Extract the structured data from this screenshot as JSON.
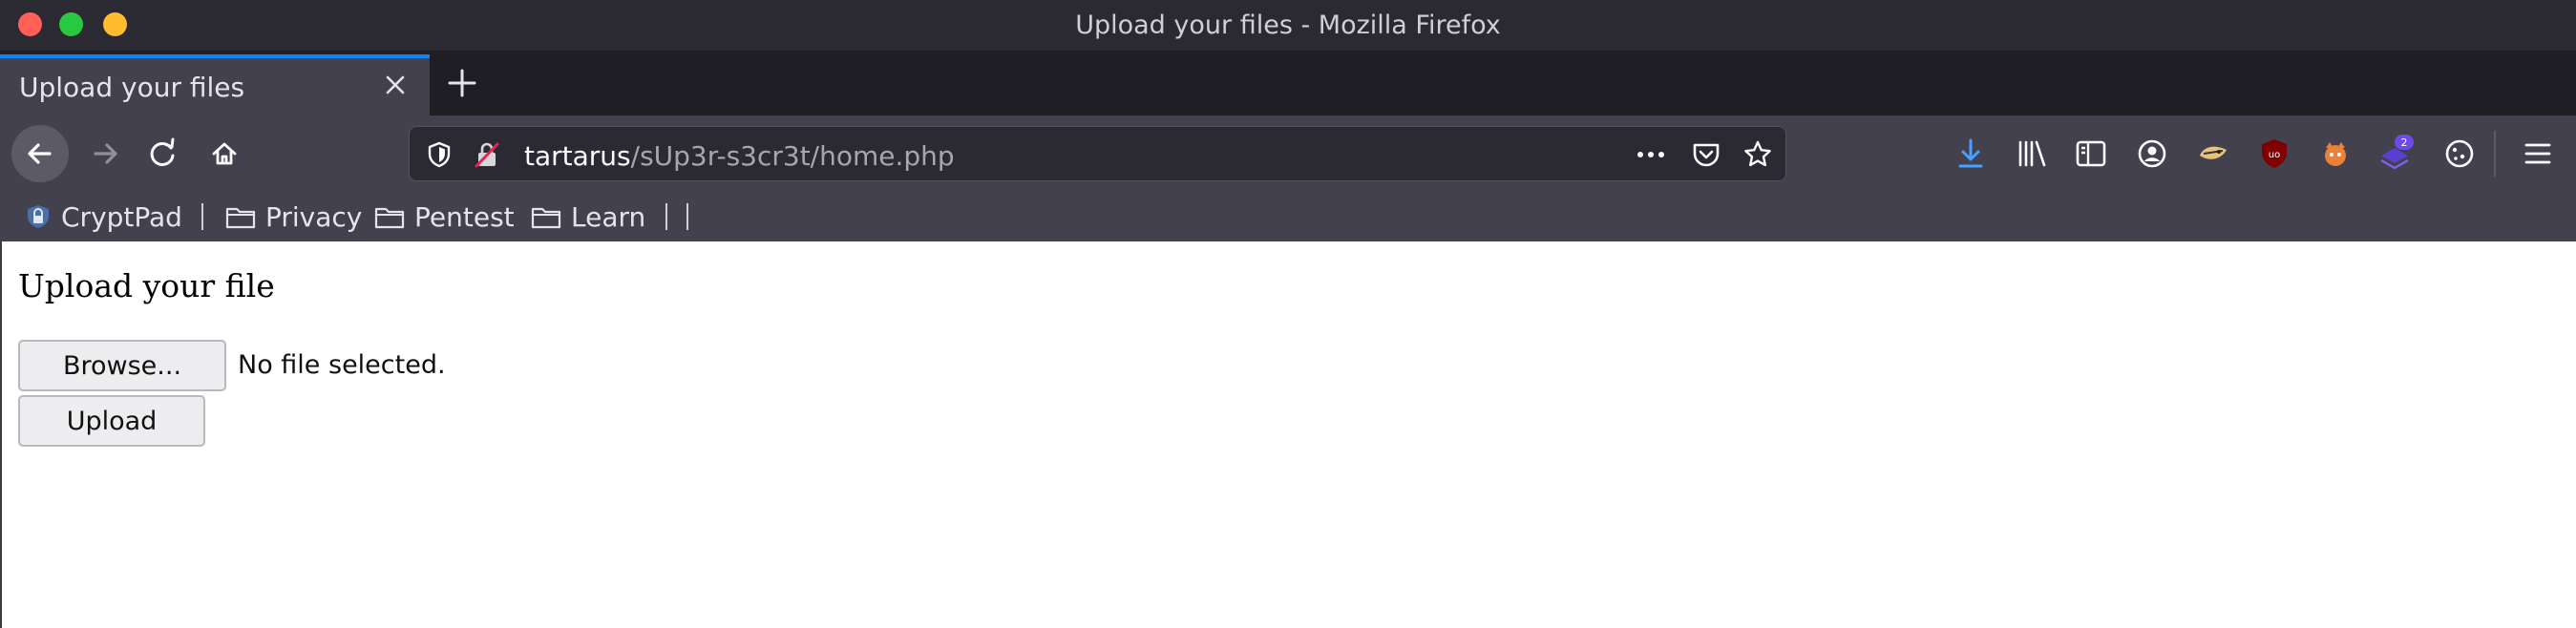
{
  "window": {
    "title": "Upload your files - Mozilla Firefox"
  },
  "tab": {
    "title": "Upload your files"
  },
  "url": {
    "host": "tartarus",
    "path": "/sUp3r-s3cr3t/home.php"
  },
  "toolbar": {
    "extension_badge": "2"
  },
  "bookmarks": {
    "items": [
      {
        "label": "CryptPad",
        "icon": "cryptpad-icon"
      },
      {
        "label": "Privacy",
        "icon": "folder-icon"
      },
      {
        "label": "Pentest",
        "icon": "folder-icon"
      },
      {
        "label": "Learn",
        "icon": "folder-icon"
      }
    ]
  },
  "page": {
    "heading": "Upload your file",
    "browse_label": "Browse...",
    "file_status": "No file selected.",
    "upload_label": "Upload"
  },
  "colors": {
    "accent": "#0a84ff",
    "chrome_dark": "#2b2a33",
    "chrome": "#42414d"
  }
}
